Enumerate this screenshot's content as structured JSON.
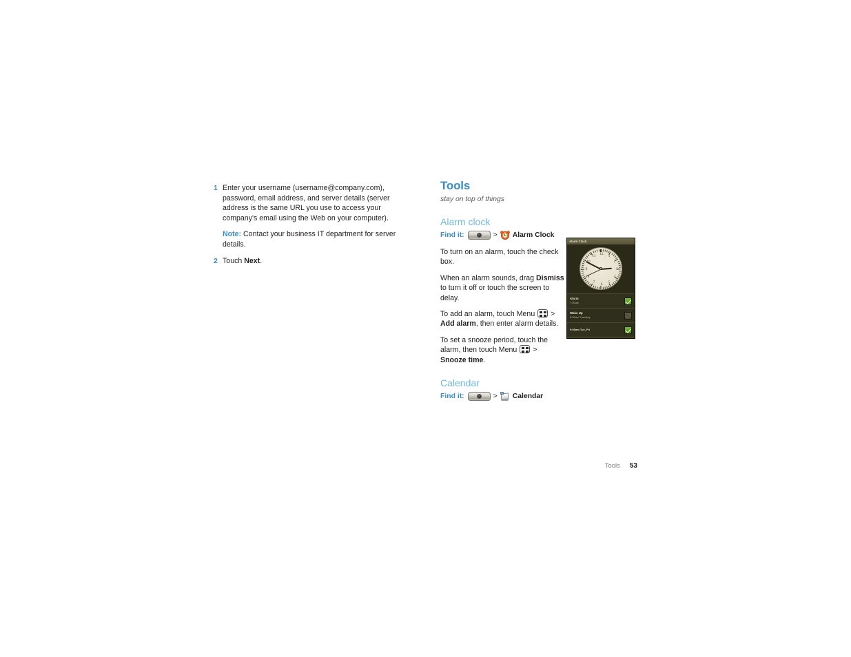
{
  "left_column": {
    "steps": [
      {
        "number": "1",
        "text": "Enter your username (username@company.com), password, email address, and server details (server address is the same URL you use to access your company's email using the Web on your computer)."
      },
      {
        "number": "2",
        "text_before": "Touch ",
        "bold": "Next",
        "text_after": "."
      }
    ],
    "note": {
      "label": "Note:",
      "text": " Contact your business IT department for server details."
    }
  },
  "right_column": {
    "section": {
      "title": "Tools",
      "subtitle": "stay on top of things"
    },
    "alarm_clock": {
      "heading": "Alarm clock",
      "find_it": {
        "label": "Find it:",
        "home_key_icon": "home-key-icon",
        "separator": ">",
        "app_icon": "alarm-clock-icon",
        "app_name": "Alarm Clock"
      },
      "paragraphs": [
        {
          "id": "p1",
          "parts": [
            {
              "type": "text",
              "value": "To turn on an alarm, touch the check box."
            }
          ]
        },
        {
          "id": "p2",
          "parts": [
            {
              "type": "text",
              "value": "When an alarm sounds, drag "
            },
            {
              "type": "bold",
              "value": "Dismiss"
            },
            {
              "type": "text",
              "value": " to turn it off or touch the screen to delay."
            }
          ]
        },
        {
          "id": "p3",
          "parts": [
            {
              "type": "text",
              "value": "To add an alarm, touch Menu "
            },
            {
              "type": "icon",
              "value": "menu-key-icon"
            },
            {
              "type": "text",
              "value": " > "
            },
            {
              "type": "bold",
              "value": "Add alarm"
            },
            {
              "type": "text",
              "value": ", then enter alarm details."
            }
          ]
        },
        {
          "id": "p4",
          "parts": [
            {
              "type": "text",
              "value": "To set a snooze period, touch the alarm, then touch Menu "
            },
            {
              "type": "icon",
              "value": "menu-key-icon"
            },
            {
              "type": "text",
              "value": " > "
            },
            {
              "type": "bold",
              "value": "Snooze time"
            },
            {
              "type": "text",
              "value": "."
            }
          ]
        }
      ]
    },
    "calendar": {
      "heading": "Calendar",
      "find_it": {
        "label": "Find it:",
        "home_key_icon": "home-key-icon",
        "separator": ">",
        "app_icon": "calendar-icon",
        "app_name": "Calendar"
      }
    }
  },
  "phone_screenshot": {
    "title": "Alarm Clock",
    "clock": {
      "numbers": [
        "12",
        "1",
        "2",
        "3",
        "4",
        "5",
        "6",
        "7",
        "8",
        "9",
        "10",
        "11"
      ],
      "hour_angle": 85,
      "minute_angle": 297,
      "second_angle": 245
    },
    "alarms": [
      {
        "name": "Alarm",
        "time": "7:00am",
        "enabled": true
      },
      {
        "name": "Wake Up",
        "time": "8:00am Tuesday",
        "enabled": false
      },
      {
        "name": "",
        "time": "9:00am Tue, Fri",
        "enabled": true
      }
    ]
  },
  "footer": {
    "chapter": "Tools",
    "page_number": "53"
  }
}
